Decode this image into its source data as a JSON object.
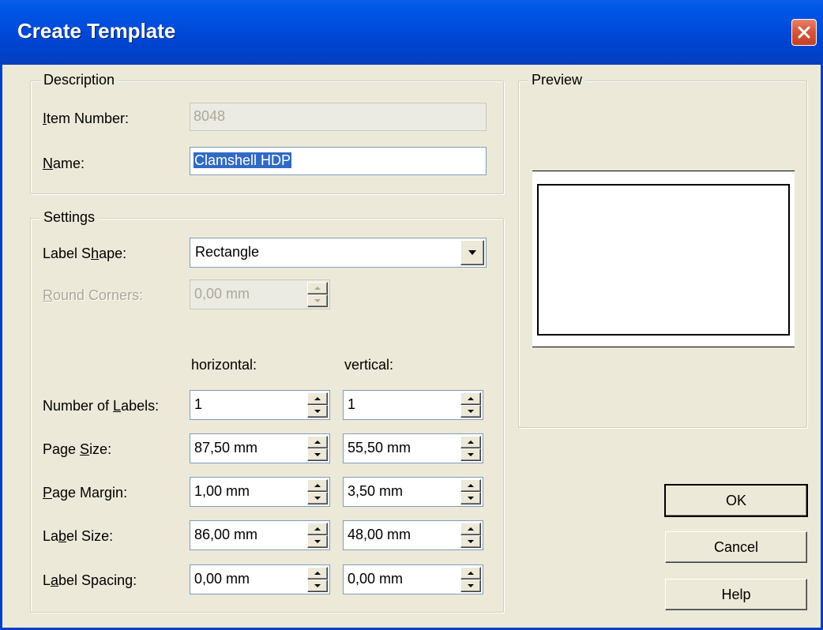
{
  "window": {
    "title": "Create Template"
  },
  "description": {
    "legend": "Description",
    "item_number_label_pre": "",
    "item_number_label_key": "I",
    "item_number_label_post": "tem Number:",
    "item_number_value": "8048",
    "name_label_key": "N",
    "name_label_post": "ame:",
    "name_value": "Clamshell HDP"
  },
  "settings": {
    "legend": "Settings",
    "label_shape_pre": "Label S",
    "label_shape_key": "h",
    "label_shape_post": "ape:",
    "label_shape_value": "Rectangle",
    "round_corners_key": "R",
    "round_corners_post": "ound Corners:",
    "round_corners_value": "0,00 mm",
    "col_horizontal": "horizontal:",
    "col_vertical": "vertical:",
    "rows": [
      {
        "label_pre": "Number of ",
        "label_key": "L",
        "label_post": "abels:",
        "h": "1",
        "v": "1"
      },
      {
        "label_pre": "Page ",
        "label_key": "S",
        "label_post": "ize:",
        "h": "87,50 mm",
        "v": "55,50 mm"
      },
      {
        "label_pre": "",
        "label_key": "P",
        "label_post": "age Margin:",
        "h": "1,00 mm",
        "v": "3,50 mm"
      },
      {
        "label_pre": "La",
        "label_key": "b",
        "label_post": "el Size:",
        "h": "86,00 mm",
        "v": "48,00 mm"
      },
      {
        "label_pre": "L",
        "label_key": "a",
        "label_post": "bel Spacing:",
        "h": "0,00 mm",
        "v": "0,00 mm"
      }
    ]
  },
  "preview": {
    "legend": "Preview"
  },
  "buttons": {
    "ok": "OK",
    "cancel": "Cancel",
    "help": "Help"
  }
}
